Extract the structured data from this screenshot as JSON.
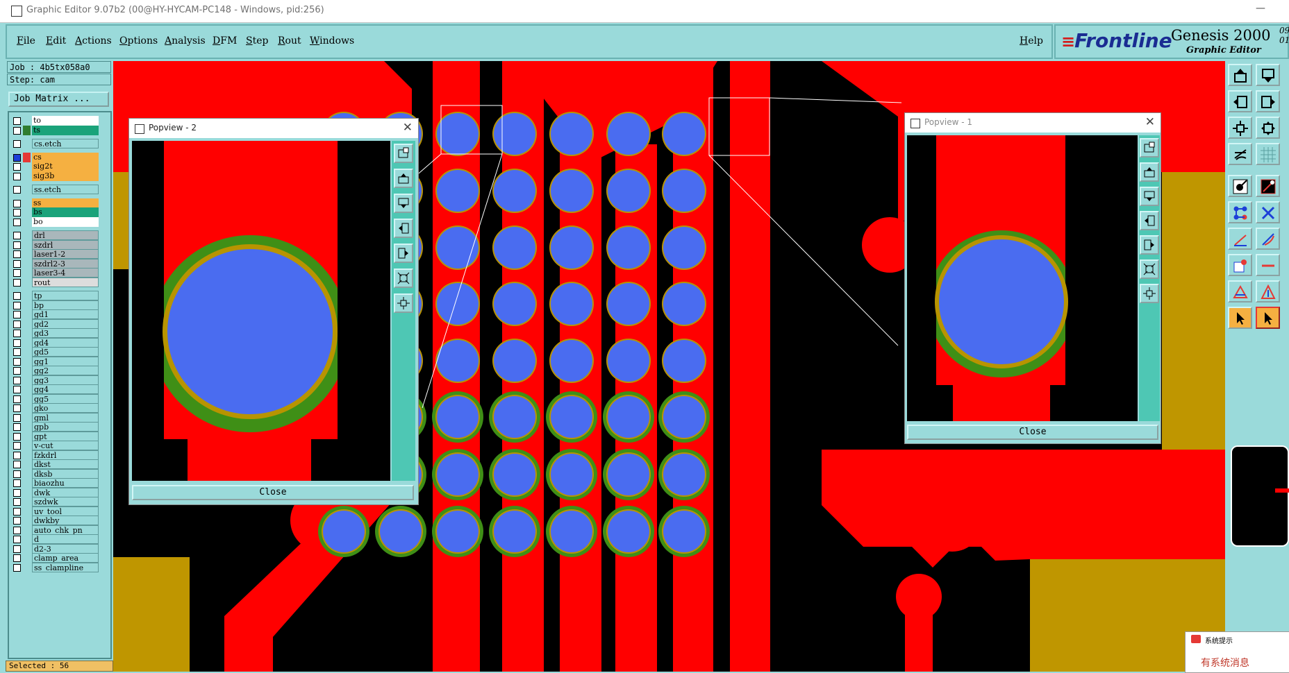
{
  "window": {
    "title": "Graphic Editor 9.07b2 (00@HY-HYCAM-PC148 - Windows, pid:256)",
    "minimize": "—"
  },
  "menu": {
    "items": [
      "File",
      "Edit",
      "Actions",
      "Options",
      "Analysis",
      "DFM",
      "Step",
      "Rout",
      "Windows"
    ],
    "help": "Help"
  },
  "brand": {
    "logo": "Frontline",
    "logo_lines": "≡",
    "product": "Genesis 2000",
    "subtitle": "Graphic Editor",
    "version_a": "09",
    "version_b": "01"
  },
  "job": {
    "job_line": "Job : 4b5tx058a0",
    "step_line": "Step: cam",
    "matrix_button": "Job Matrix ..."
  },
  "layers": [
    {
      "name": "to",
      "color": "#ffffff"
    },
    {
      "name": "ts",
      "color": "#1aa37a",
      "mark": "#2f7d2f"
    },
    {
      "name": "cs.etch",
      "color": "#9adada"
    },
    {
      "name": "cs",
      "color": "#f5b041",
      "mark": "#e53935",
      "active": true
    },
    {
      "name": "sig2t",
      "color": "#f5b041"
    },
    {
      "name": "sig3b",
      "color": "#f5b041"
    },
    {
      "name": "ss.etch",
      "color": "#9adada"
    },
    {
      "name": "ss",
      "color": "#f5b041"
    },
    {
      "name": "bs",
      "color": "#1aa37a"
    },
    {
      "name": "bo",
      "color": "#ffffff"
    },
    {
      "name": "drl",
      "color": "#a9b7bb"
    },
    {
      "name": "szdrl",
      "color": "#a9b7bb"
    },
    {
      "name": "laser1-2",
      "color": "#a9b7bb"
    },
    {
      "name": "szdrl2-3",
      "color": "#a9b7bb"
    },
    {
      "name": "laser3-4",
      "color": "#a9b7bb"
    },
    {
      "name": "rout",
      "color": "#dddddd"
    },
    {
      "name": "tp",
      "color": "#9adada"
    },
    {
      "name": "bp",
      "color": "#9adada"
    },
    {
      "name": "gd1",
      "color": "#9adada"
    },
    {
      "name": "gd2",
      "color": "#9adada"
    },
    {
      "name": "gd3",
      "color": "#9adada"
    },
    {
      "name": "gd4",
      "color": "#9adada"
    },
    {
      "name": "gd5",
      "color": "#9adada"
    },
    {
      "name": "gg1",
      "color": "#9adada"
    },
    {
      "name": "gg2",
      "color": "#9adada"
    },
    {
      "name": "gg3",
      "color": "#9adada"
    },
    {
      "name": "gg4",
      "color": "#9adada"
    },
    {
      "name": "gg5",
      "color": "#9adada"
    },
    {
      "name": "gko",
      "color": "#9adada"
    },
    {
      "name": "gml",
      "color": "#9adada"
    },
    {
      "name": "gpb",
      "color": "#9adada"
    },
    {
      "name": "gpt",
      "color": "#9adada"
    },
    {
      "name": "v-cut",
      "color": "#9adada"
    },
    {
      "name": "fzkdrl",
      "color": "#9adada"
    },
    {
      "name": "dkst",
      "color": "#9adada"
    },
    {
      "name": "dksb",
      "color": "#9adada"
    },
    {
      "name": "biaozhu",
      "color": "#9adada"
    },
    {
      "name": "dwk",
      "color": "#9adada"
    },
    {
      "name": "szdwk",
      "color": "#9adada"
    },
    {
      "name": "uv_tool",
      "color": "#9adada"
    },
    {
      "name": "dwkby",
      "color": "#9adada"
    },
    {
      "name": "auto_chk_pn",
      "color": "#9adada"
    },
    {
      "name": "d",
      "color": "#9adada"
    },
    {
      "name": "d2-3",
      "color": "#9adada"
    },
    {
      "name": "clamp_area",
      "color": "#9adada"
    },
    {
      "name": "ss_clampline",
      "color": "#9adada"
    }
  ],
  "status": {
    "selected": "Selected : 56"
  },
  "popview2": {
    "title": "Popview - 2",
    "close_label": "Close"
  },
  "popview1": {
    "title": "Popview - 1",
    "close_label": "Close"
  },
  "notification": {
    "title": "系统提示",
    "body": "有系统消息"
  },
  "colors": {
    "copper": "#ff0000",
    "pad": "#4a6cf0",
    "mask": "#3f8f16",
    "substrate": "#000000",
    "plane": "#bf9600",
    "outline": "#b89400"
  },
  "icons": {
    "window": "app-icon",
    "tools_right": [
      "zoom-home-icon",
      "zoom-back-icon",
      "pan-left-icon",
      "pan-right-icon",
      "fit-screen-icon",
      "fit-profile-icon",
      "grid-icon",
      "snap-icon",
      "measure-icon",
      "highlight-icon",
      "net-icon",
      "cross-icon",
      "line-tool-icon",
      "arc-tool-icon",
      "pad-tool-icon",
      "dash-tool-icon",
      "triangle-icon",
      "triangle-select-icon",
      "pointer-icon",
      "pointer-select-icon"
    ]
  }
}
